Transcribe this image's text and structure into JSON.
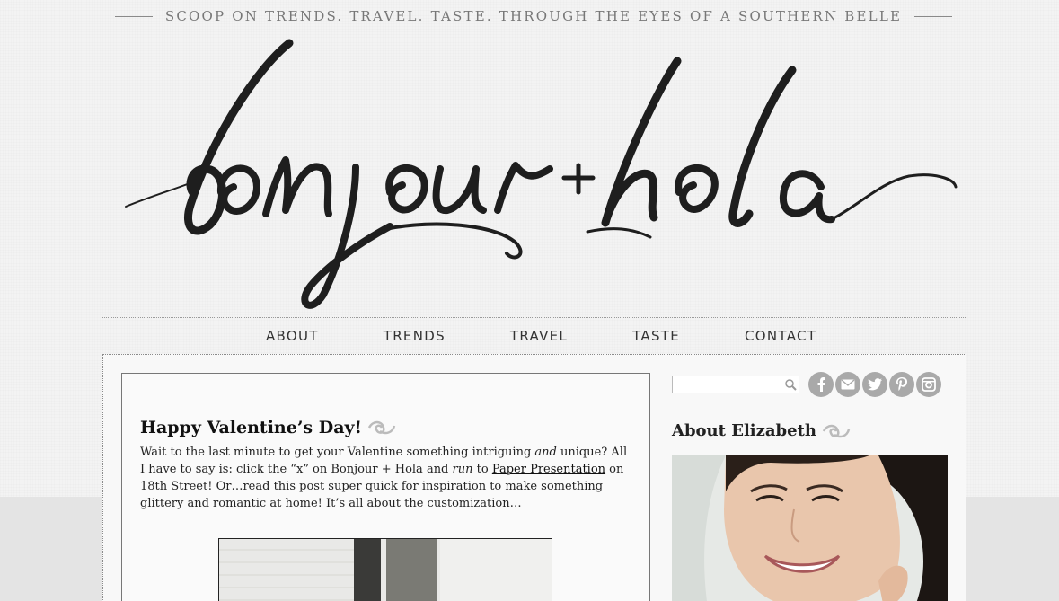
{
  "header": {
    "tagline": "SCOOP ON TRENDS. TRAVEL. TASTE. THROUGH THE EYES OF A SOUTHERN BELLE",
    "logo_text": "bonjour + hola"
  },
  "nav": {
    "items": [
      {
        "label": "ABOUT"
      },
      {
        "label": "TRENDS"
      },
      {
        "label": "TRAVEL"
      },
      {
        "label": "TASTE"
      },
      {
        "label": "CONTACT"
      }
    ]
  },
  "post": {
    "title": "Happy Valentine’s Day!",
    "excerpt": {
      "part1": "Wait to the last minute to get your Valentine something intriguing ",
      "em1": "and",
      "part2": " unique? All I have to say is: click the “x” on Bonjour + Hola and ",
      "em2": "run",
      "part3": " to ",
      "link": "Paper Presentation",
      "part4": " on 18th Street! Or…read this post super quick for inspiration to make something glittery and romantic at home! It’s all about the customization…"
    }
  },
  "sidebar": {
    "search": {
      "value": "",
      "placeholder": ""
    },
    "social_icons": [
      "facebook-icon",
      "email-icon",
      "twitter-icon",
      "pinterest-icon",
      "instagram-icon"
    ],
    "about_title": "About Elizabeth"
  },
  "colors": {
    "background": "#f3f3f3",
    "social_icon": "#a9a9a9",
    "text": "#222222"
  }
}
